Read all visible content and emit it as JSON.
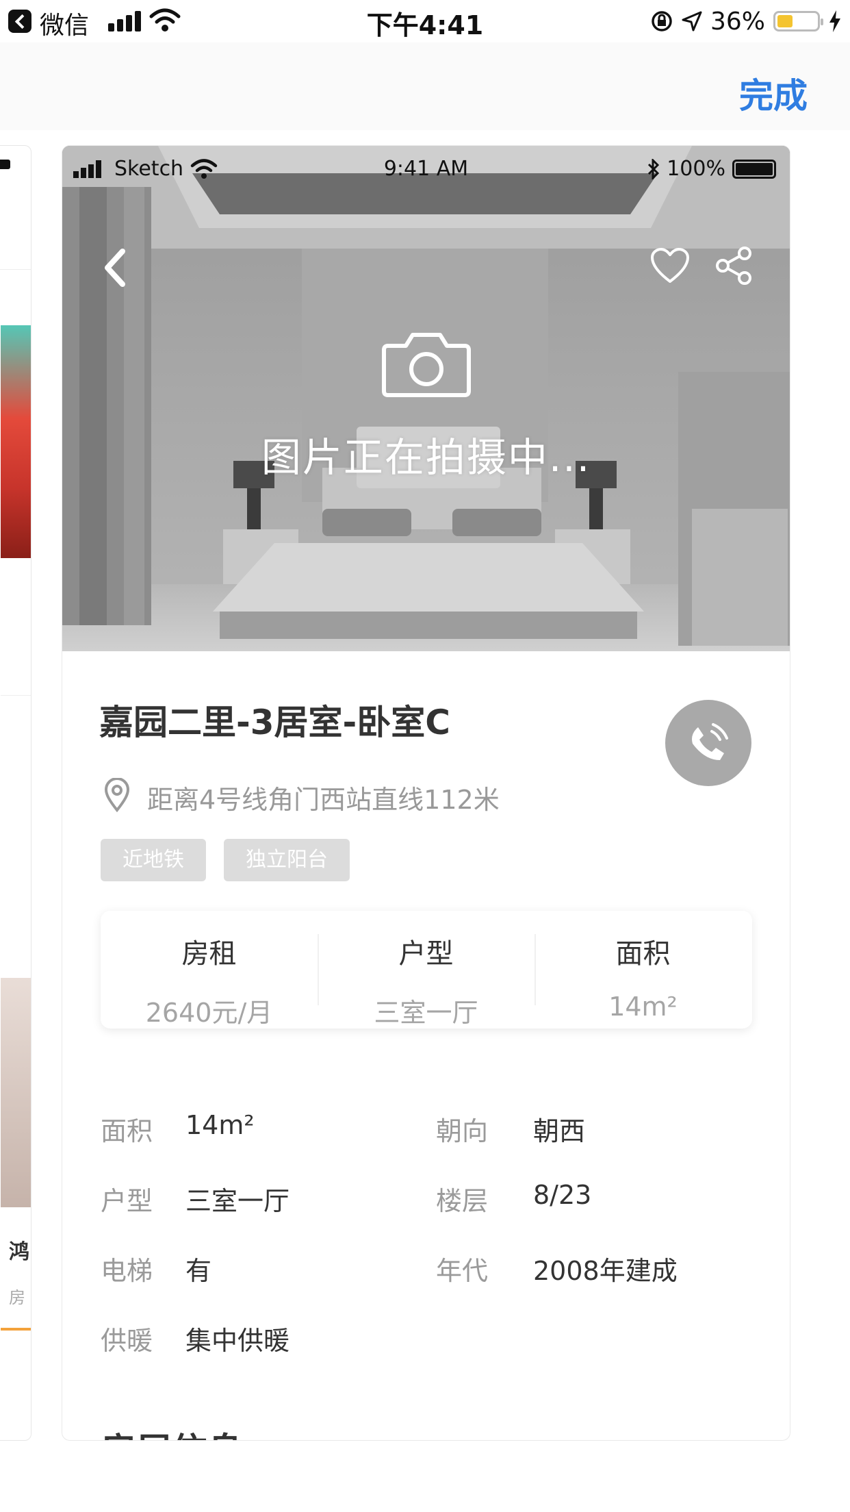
{
  "status_bar": {
    "app": "微信",
    "time": "下午4:41",
    "battery": "36%"
  },
  "nav": {
    "done": "完成"
  },
  "peek_card": {
    "title": "鸿",
    "sub": "房"
  },
  "hero": {
    "inner_status": {
      "carrier": "Sketch",
      "time": "9:41 AM",
      "battery": "100%"
    },
    "caption": "图片正在拍摄中..."
  },
  "listing": {
    "title": "嘉园二里-3居室-卧室C",
    "location": "距离4号线角门西站直线112米",
    "tags": [
      "近地铁",
      "独立阳台"
    ]
  },
  "summary": [
    {
      "label": "房租",
      "value": "2640元/月"
    },
    {
      "label": "户型",
      "value": "三室一厅"
    },
    {
      "label": "面积",
      "value": "14m²"
    }
  ],
  "details": {
    "area_label": "面积",
    "area_value": "14m²",
    "orientation_label": "朝向",
    "orientation_value": "朝西",
    "layout_label": "户型",
    "layout_value": "三室一厅",
    "floor_label": "楼层",
    "floor_value": "8/23",
    "elevator_label": "电梯",
    "elevator_value": "有",
    "year_label": "年代",
    "year_value": "2008年建成",
    "heating_label": "供暖",
    "heating_value": "集中供暖"
  },
  "section_title": "房屋信息",
  "colors": {
    "accent": "#2f7de1",
    "tag_bg": "#dcdcdc",
    "phone_btn": "#a9a9a9"
  }
}
